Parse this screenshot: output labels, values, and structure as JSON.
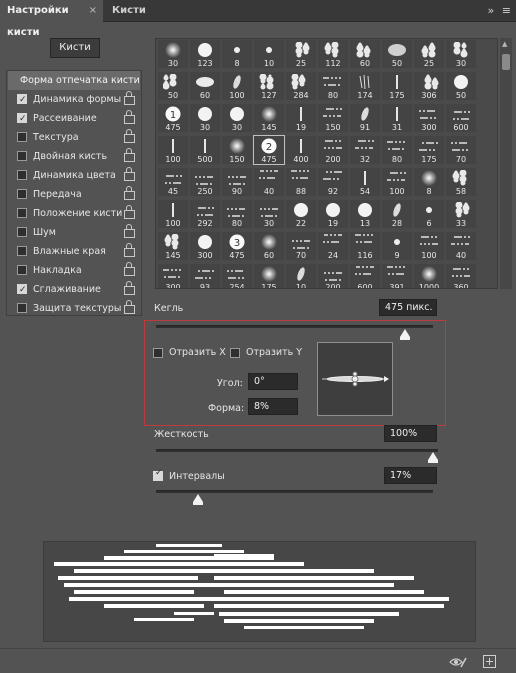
{
  "tabs": {
    "active_label": "Настройки кисти",
    "inactive_label": "Кисти",
    "close_symbol": "×",
    "collapse_symbol": "»",
    "menu_symbol": "≡"
  },
  "brushes_button": "Кисти",
  "brush_tip_header": "Форма отпечатка кисти",
  "options": [
    {
      "label": "Динамика формы",
      "checked": true
    },
    {
      "label": "Рассеивание",
      "checked": true
    },
    {
      "label": "Текстура",
      "checked": false
    },
    {
      "label": "Двойная кисть",
      "checked": false
    },
    {
      "label": "Динамика цвета",
      "checked": false
    },
    {
      "label": "Передача",
      "checked": false
    },
    {
      "label": "Положение кисти",
      "checked": false
    },
    {
      "label": "Шум",
      "checked": false
    },
    {
      "label": "Влажные края",
      "checked": false
    },
    {
      "label": "Накладка",
      "checked": false
    },
    {
      "label": "Сглаживание",
      "checked": true
    },
    {
      "label": "Защита текстуры",
      "checked": false
    }
  ],
  "brush_presets": [
    "30",
    "123",
    "8",
    "10",
    "25",
    "112",
    "60",
    "50",
    "25",
    "30",
    "50",
    "60",
    "100",
    "127",
    "284",
    "80",
    "174",
    "175",
    "306",
    "50",
    "475",
    "30",
    "30",
    "145",
    "19",
    "150",
    "91",
    "31",
    "300",
    "600",
    "100",
    "500",
    "150",
    "475",
    "400",
    "200",
    "32",
    "80",
    "175",
    "70",
    "45",
    "250",
    "90",
    "40",
    "88",
    "92",
    "54",
    "100",
    "8",
    "58",
    "100",
    "292",
    "80",
    "30",
    "22",
    "19",
    "13",
    "28",
    "6",
    "33",
    "145",
    "300",
    "475",
    "60",
    "70",
    "24",
    "116",
    "9",
    "100",
    "40",
    "300",
    "93",
    "254",
    "175",
    "10",
    "200",
    "600",
    "391",
    "1000",
    "360"
  ],
  "brush_shapes": [
    "soft",
    "hard",
    "dot",
    "dot",
    "splat",
    "splat",
    "splat",
    "ring",
    "splat",
    "splat",
    "splat",
    "oval",
    "leaf",
    "splat",
    "splat",
    "scatter",
    "hair",
    "line",
    "splat",
    "hard",
    "num1",
    "hard",
    "hard",
    "soft",
    "line",
    "scatter",
    "leaf",
    "line",
    "scatter",
    "scatter",
    "line",
    "line",
    "soft",
    "num2",
    "line",
    "scatter",
    "scatter",
    "scatter",
    "scatter",
    "scatter",
    "scatter",
    "scatter",
    "scatter",
    "scatter",
    "scatter",
    "scatter",
    "line",
    "scatter",
    "soft",
    "splat",
    "line",
    "scatter",
    "scatter",
    "scatter",
    "hard",
    "hard",
    "hard",
    "leaf",
    "dot",
    "splat",
    "splat",
    "hard",
    "num3",
    "soft",
    "scatter",
    "scatter",
    "scatter",
    "dot",
    "scatter",
    "scatter",
    "scatter",
    "scatter",
    "scatter",
    "soft",
    "leaf",
    "scatter",
    "scatter",
    "scatter",
    "soft",
    "scatter"
  ],
  "selected_brush_index": 33,
  "size": {
    "label": "Кегль",
    "value": "475 пикс.",
    "slider_fraction": 0.9
  },
  "flip_x": {
    "label": "Отразить X",
    "checked": false
  },
  "flip_y": {
    "label": "Отразить Y",
    "checked": false
  },
  "angle": {
    "label": "Угол:",
    "value": "0°"
  },
  "roundness": {
    "label": "Форма:",
    "value": "8%"
  },
  "hardness": {
    "label": "Жесткость",
    "value": "100%",
    "slider_fraction": 1.0
  },
  "spacing": {
    "label": "Интервалы",
    "value": "17%",
    "checked": true,
    "slider_fraction": 0.15
  },
  "bottom_icons": [
    "eye-brush-icon",
    "new-preset-icon"
  ],
  "colors": {
    "panel_bg": "#535353",
    "tab_bar": "#383838",
    "input_bg": "#2b2b2b",
    "highlight_border": "#c0393b"
  }
}
